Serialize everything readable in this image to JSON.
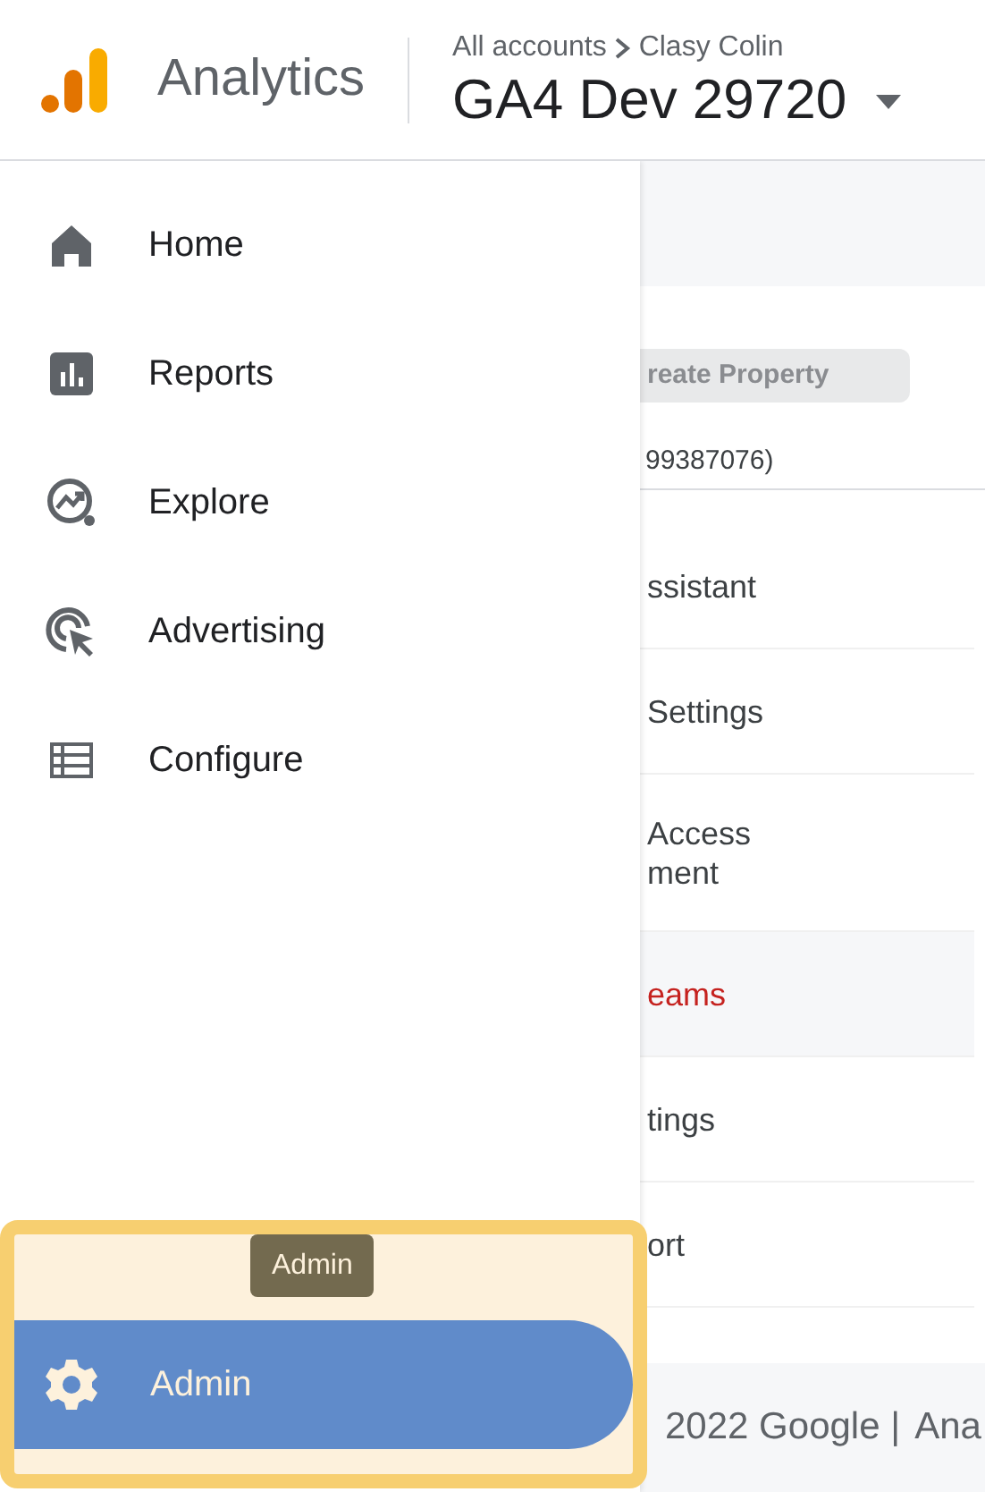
{
  "header": {
    "product": "Analytics",
    "breadcrumb": [
      "All accounts",
      "Clasy Colin"
    ],
    "property": "GA4 Dev 29720"
  },
  "nav": [
    {
      "label": "Home",
      "kind": "home"
    },
    {
      "label": "Reports",
      "kind": "reports"
    },
    {
      "label": "Explore",
      "kind": "explore"
    },
    {
      "label": "Advertising",
      "kind": "advertising"
    },
    {
      "label": "Configure",
      "kind": "configure"
    }
  ],
  "admin": {
    "label": "Admin",
    "tooltip": "Admin",
    "highlighted": true
  },
  "background": {
    "button": "reate Property",
    "account_id": "99387076)",
    "rows": [
      {
        "lines": [
          "ssistant"
        ],
        "selected": false
      },
      {
        "lines": [
          "Settings"
        ],
        "selected": false
      },
      {
        "lines": [
          "Access",
          "ment"
        ],
        "selected": false
      },
      {
        "lines": [
          "eams"
        ],
        "selected": true
      },
      {
        "lines": [
          "tings"
        ],
        "selected": false
      },
      {
        "lines": [
          "ort"
        ],
        "selected": false
      }
    ],
    "footer": {
      "text": "2022 Google |",
      "link": "Ana"
    }
  }
}
